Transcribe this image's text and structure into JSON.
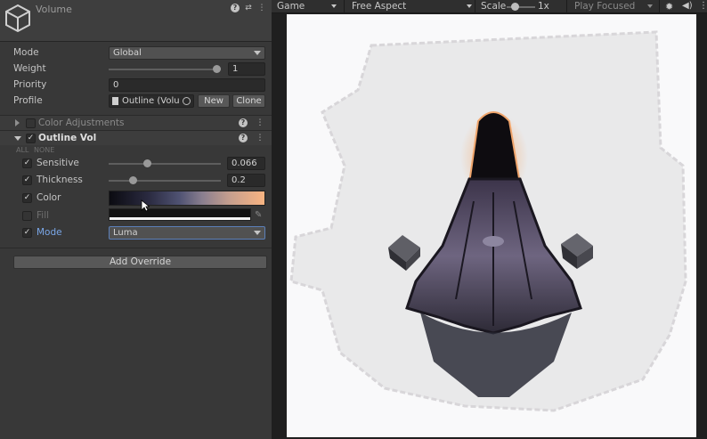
{
  "inspector": {
    "title": "Volume",
    "properties": {
      "mode_label": "Mode",
      "mode_value": "Global",
      "weight_label": "Weight",
      "weight_value": "1",
      "weight_fraction": 1,
      "priority_label": "Priority",
      "priority_value": "0",
      "profile_label": "Profile",
      "profile_value": "Outline (Volu",
      "new_button": "New",
      "clone_button": "Clone"
    },
    "sections": {
      "color_adjustments": "Color Adjustments",
      "outline_vol": "Outline Vol"
    },
    "all_none": {
      "all": "ALL",
      "none": "NONE"
    },
    "outline": {
      "sensitive_label": "Sensitive",
      "sensitive_value": "0.066",
      "sensitive_fraction": 0.33,
      "thickness_label": "Thickness",
      "thickness_value": "0.2",
      "thickness_fraction": 0.2,
      "color_label": "Color",
      "fill_label": "Fill",
      "mode_label": "Mode",
      "mode_value": "Luma"
    },
    "add_override": "Add Override"
  },
  "gamebar": {
    "view": "Game",
    "aspect": "Free Aspect",
    "scale_label": "Scale",
    "scale_value": "1x",
    "play_focused": "Play Focused"
  },
  "colors": {
    "accent_blue": "#7aa7e8",
    "gradient_start": "#0b0b11",
    "gradient_end": "#f8b482"
  }
}
